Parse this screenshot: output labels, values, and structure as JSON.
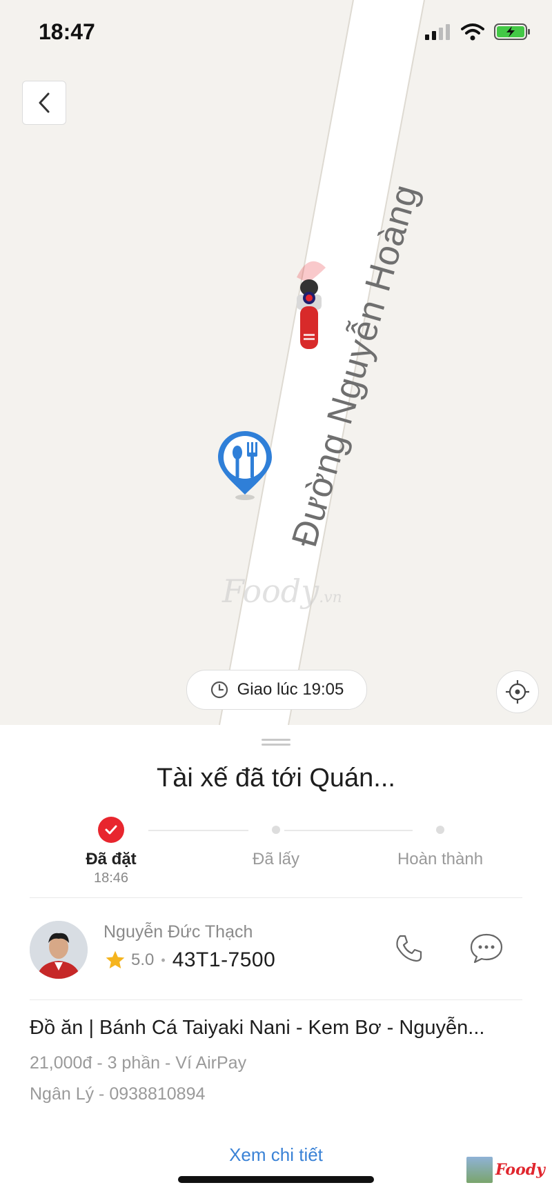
{
  "status_bar": {
    "time": "18:47"
  },
  "map": {
    "road_name": "Đường Nguyễn Hoàng",
    "watermark": "Foody",
    "watermark_suffix": ".vn",
    "eta_label": "Giao lúc 19:05"
  },
  "panel": {
    "title": "Tài xế đã tới Quán...",
    "steps": [
      {
        "label": "Đã đặt",
        "time": "18:46",
        "done": true
      },
      {
        "label": "Đã lấy",
        "time": "",
        "done": false
      },
      {
        "label": "Hoàn thành",
        "time": "",
        "done": false
      }
    ],
    "driver": {
      "name": "Nguyễn Đức Thạch",
      "rating": "5.0",
      "plate": "43T1-7500"
    },
    "order": {
      "title": "Đồ ăn | Bánh Cá Taiyaki Nani - Kem Bơ - Nguyễn...",
      "summary": "21,000đ - 3 phần - Ví AirPay",
      "contact": "Ngân Lý - 0938810894"
    },
    "detail_link": "Xem chi tiết",
    "brand": "Foody"
  },
  "colors": {
    "accent_red": "#e8262e",
    "link_blue": "#3a82d6",
    "pin_blue": "#2f7fd8"
  }
}
